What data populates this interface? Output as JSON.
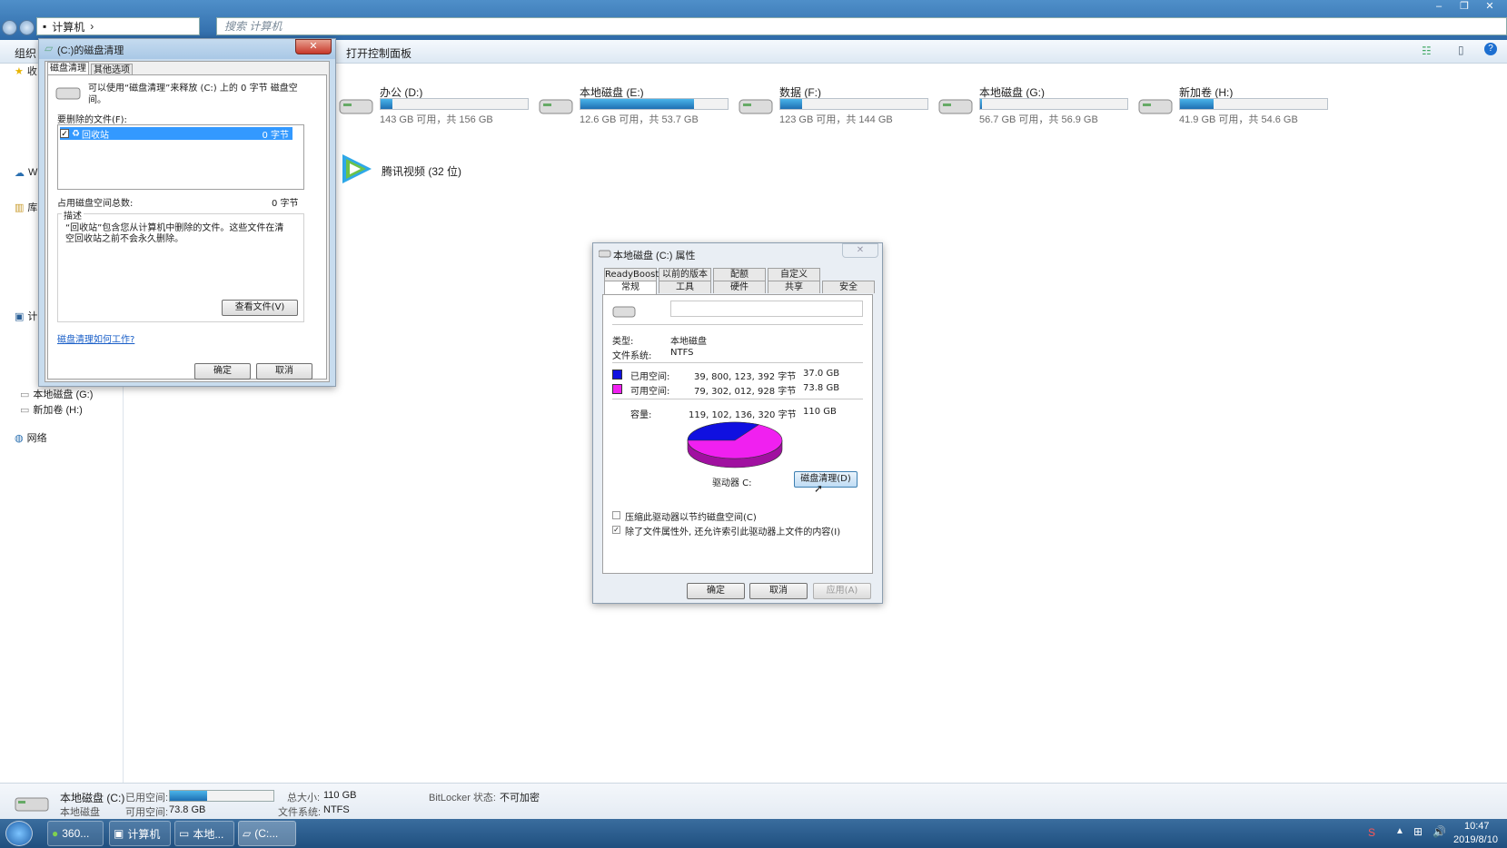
{
  "explorer": {
    "address": "计算机",
    "search_placeholder": "搜索 计算机",
    "cmd": {
      "organize": "组织",
      "open_control_panel": "打开控制面板"
    },
    "nav": {
      "fav": "收",
      "wlan": "W",
      "lib": "库",
      "computer": "计",
      "drive_g": "本地磁盘 (G:)",
      "drive_h": "新加卷 (H:)",
      "network": "网络"
    },
    "drives": [
      {
        "name": "办公 (D:)",
        "info": "143 GB 可用，共 156 GB",
        "used_fraction": 0.08
      },
      {
        "name": "本地磁盘 (E:)",
        "info": "12.6 GB 可用，共 53.7 GB",
        "used_fraction": 0.77
      },
      {
        "name": "数据 (F:)",
        "info": "123 GB 可用，共 144 GB",
        "used_fraction": 0.15
      },
      {
        "name": "本地磁盘 (G:)",
        "info": "56.7 GB 可用，共 56.9 GB",
        "used_fraction": 0.01
      },
      {
        "name": "新加卷 (H:)",
        "info": "41.9 GB 可用，共 54.6 GB",
        "used_fraction": 0.23
      }
    ],
    "app": {
      "name": "腾讯视频 (32 位)"
    }
  },
  "details": {
    "drive_name": "本地磁盘 (C:)",
    "drive_type": "本地磁盘",
    "used_label": "已用空间:",
    "free_label": "可用空间:",
    "free_value": "73.8 GB",
    "total_label": "总大小:",
    "total_value": "110 GB",
    "fs_label": "文件系统:",
    "fs_value": "NTFS",
    "bitlocker_label": "BitLocker 状态:",
    "bitlocker_value": "不可加密",
    "used_fraction": 0.36
  },
  "cleanup": {
    "title": "(C:)的磁盘清理",
    "tabs": [
      "磁盘清理",
      "其他选项"
    ],
    "intro": "可以使用“磁盘清理”来释放 (C:) 上的 0 字节 磁盘空间。",
    "files_label": "要删除的文件(F):",
    "item_name": "回收站",
    "item_size": "0 字节",
    "total_label": "占用磁盘空间总数:",
    "total_value": "0 字节",
    "desc_label": "描述",
    "desc_text": "“回收站”包含您从计算机中删除的文件。这些文件在清空回收站之前不会永久删除。",
    "view_files": "查看文件(V)",
    "how_link": "磁盘清理如何工作?",
    "ok": "确定",
    "cancel": "取消"
  },
  "props": {
    "title": "本地磁盘 (C:) 属性",
    "tabs_top": [
      "ReadyBoost",
      "以前的版本",
      "配额",
      "自定义"
    ],
    "tabs_bottom": [
      "常规",
      "工具",
      "硬件",
      "共享",
      "安全"
    ],
    "type_label": "类型:",
    "type_value": "本地磁盘",
    "fs_label": "文件系统:",
    "fs_value": "NTFS",
    "used_label": "已用空间:",
    "used_bytes": "39, 800, 123, 392 字节",
    "used_gb": "37.0 GB",
    "free_label": "可用空间:",
    "free_bytes": "79, 302, 012, 928 字节",
    "free_gb": "73.8 GB",
    "cap_label": "容量:",
    "cap_bytes": "119, 102, 136, 320 字节",
    "cap_gb": "110 GB",
    "drive_label": "驱动器 C:",
    "cleanup_btn": "磁盘清理(D)",
    "compress": "压缩此驱动器以节约磁盘空间(C)",
    "index": "除了文件属性外, 还允许索引此驱动器上文件的内容(I)",
    "ok": "确定",
    "cancel": "取消",
    "apply": "应用(A)",
    "used_color": "#1010e0",
    "free_color": "#f020f0",
    "used_fraction": 0.334
  },
  "taskbar": {
    "items": [
      "360...",
      "计算机",
      "本地...",
      "(C:..."
    ],
    "time": "10:47",
    "date": "2019/8/10"
  }
}
